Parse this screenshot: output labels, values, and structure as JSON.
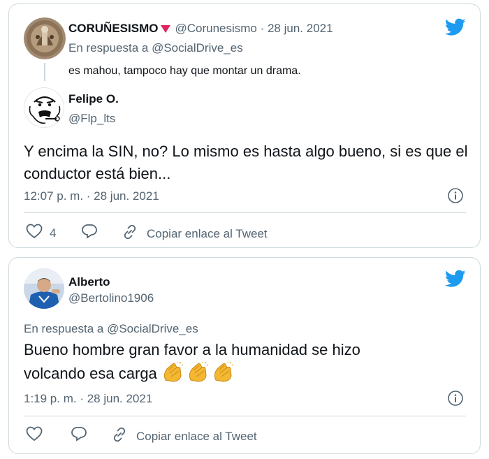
{
  "tweet1": {
    "quoted": {
      "name": "CORUÑESISMO",
      "handle_date": "@Corunesismo · 28 jun. 2021",
      "reply_prefix": "En respuesta a ",
      "reply_user": "@SocialDrive_es",
      "text": "es mahou, tampoco hay que montar un drama."
    },
    "author": {
      "name": "Felipe O.",
      "handle": "@Flp_lts"
    },
    "text": "Y encima la SIN, no? Lo mismo es hasta algo bueno, si es que el conductor está bien...",
    "timestamp": "12:07 p. m. · 28 jun. 2021",
    "likes": "4",
    "copy_link": "Copiar enlace al Tweet"
  },
  "tweet2": {
    "author": {
      "name": "Alberto",
      "handle": "@Bertolino1906"
    },
    "reply_prefix": "En respuesta a ",
    "reply_user": "@SocialDrive_es",
    "text_line1": "Bueno hombre gran favor a la humanidad se hizo",
    "text_line2": "volcando esa carga",
    "emoji": "clapping-hands-icon x3",
    "timestamp": "1:19 p. m. · 28 jun. 2021",
    "copy_link": "Copiar enlace al Tweet"
  },
  "colors": {
    "twitter_blue": "#1d9bf0",
    "gray": "#536471",
    "border": "#cfd9de",
    "verified_triangle": "#e0245e"
  }
}
